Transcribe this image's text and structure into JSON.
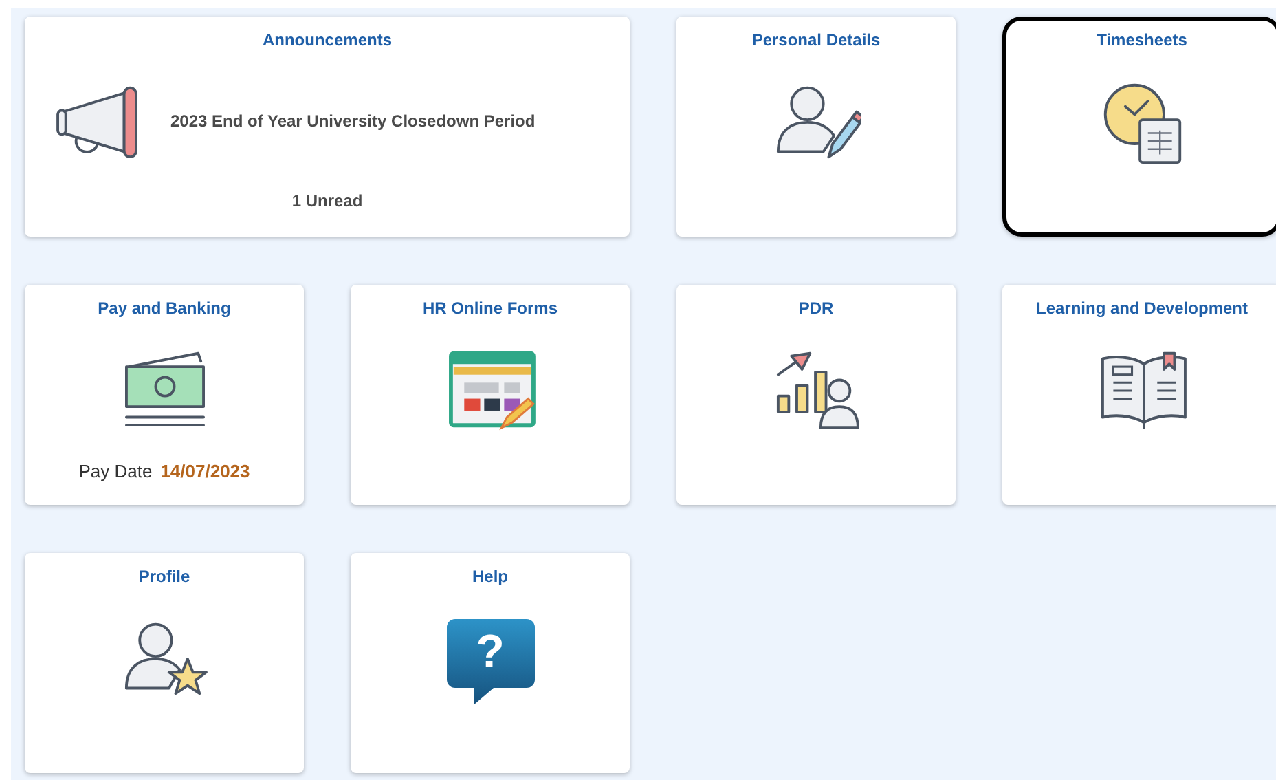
{
  "tiles": [
    {
      "title": "Announcements",
      "kind": "megaphone",
      "wide": true,
      "focused": false,
      "message": "2023 End of Year University Closedown Period",
      "footer": "1 Unread"
    },
    {
      "title": "Personal Details",
      "kind": "person-pencil",
      "wide": false,
      "focused": false
    },
    {
      "title": "Timesheets",
      "kind": "clock-sheet",
      "wide": false,
      "focused": true
    },
    {
      "title": "Pay and Banking",
      "kind": "money",
      "wide": false,
      "focused": false,
      "footer_label": "Pay Date",
      "footer_value": "14/07/2023"
    },
    {
      "title": "HR Online Forms",
      "kind": "form",
      "wide": false,
      "focused": false
    },
    {
      "title": "PDR",
      "kind": "chart-person",
      "wide": false,
      "focused": false
    },
    {
      "title": "Learning and Development",
      "kind": "book",
      "wide": false,
      "focused": false
    },
    {
      "title": "Profile",
      "kind": "person-star",
      "wide": false,
      "focused": false
    },
    {
      "title": "Help",
      "kind": "help",
      "wide": false,
      "focused": false,
      "glyph": "?"
    }
  ]
}
